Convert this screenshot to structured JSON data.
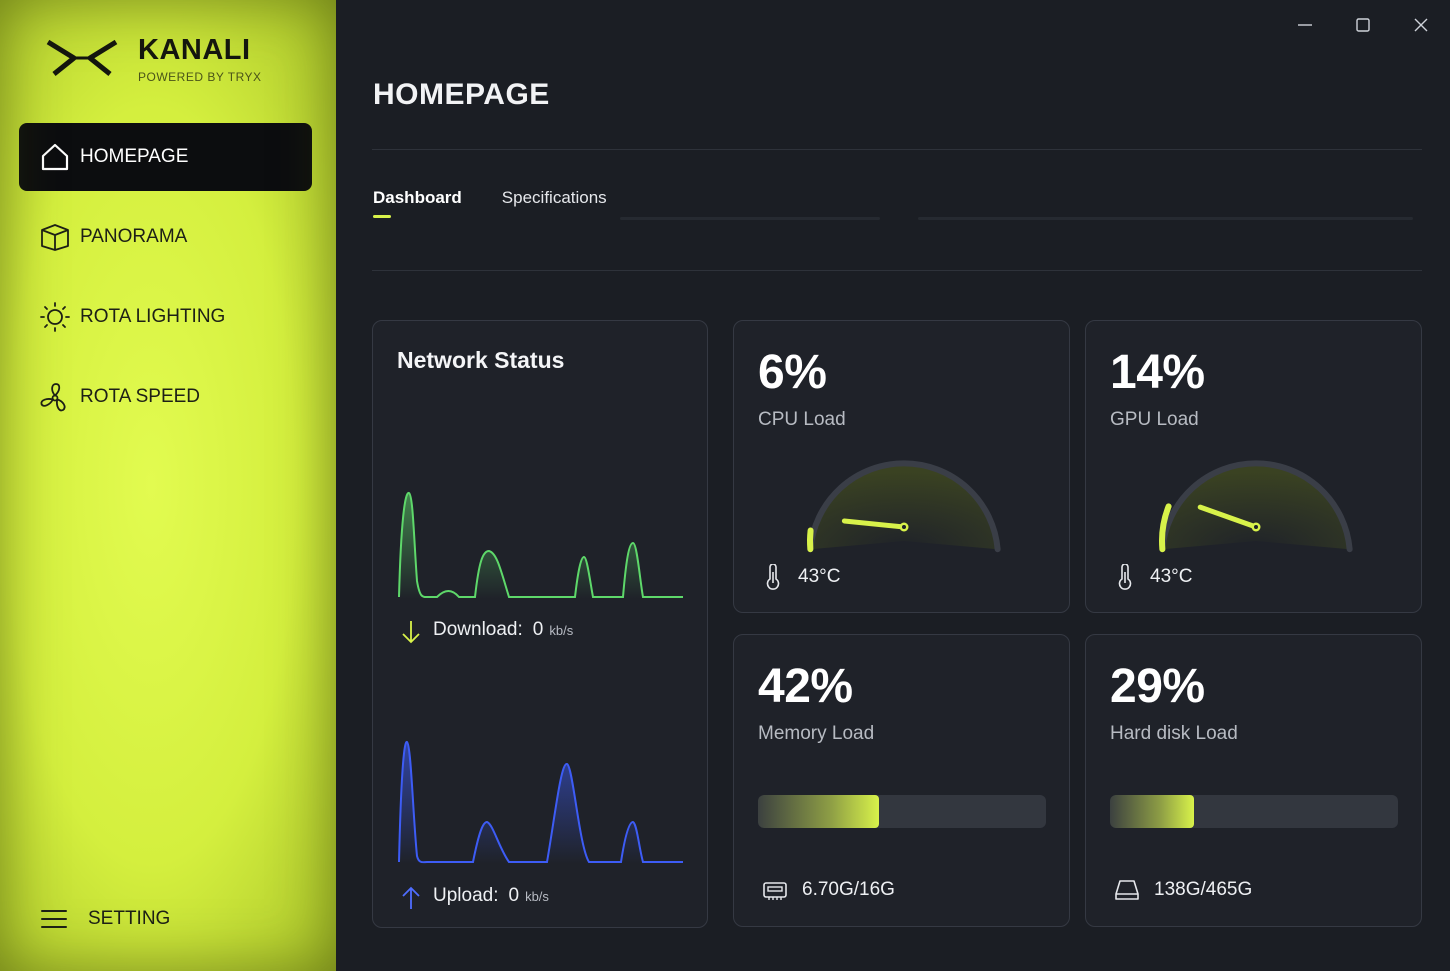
{
  "brand": {
    "name": "KANALI",
    "subtitle": "POWERED BY TRYX"
  },
  "nav": [
    {
      "label": "HOMEPAGE",
      "icon": "home-icon",
      "active": true
    },
    {
      "label": "PANORAMA",
      "icon": "box-icon",
      "active": false
    },
    {
      "label": "ROTA LIGHTING",
      "icon": "sun-icon",
      "active": false
    },
    {
      "label": "ROTA SPEED",
      "icon": "fan-icon",
      "active": false
    }
  ],
  "setting": {
    "label": "SETTING",
    "icon": "menu-icon"
  },
  "window": {
    "controls": [
      "minimize-icon",
      "maximize-icon",
      "close-icon"
    ]
  },
  "page": {
    "title": "HOMEPAGE"
  },
  "tabs": [
    {
      "label": "Dashboard",
      "active": true
    },
    {
      "label": "Specifications",
      "active": false
    }
  ],
  "network": {
    "title": "Network Status",
    "download": {
      "label": "Download:",
      "value": "0",
      "unit": "kb/s",
      "color": "#5ed86a"
    },
    "upload": {
      "label": "Upload:",
      "value": "0",
      "unit": "kb/s",
      "color": "#3d5cf5"
    }
  },
  "cpu": {
    "value": "6%",
    "label": "CPU Load",
    "temp": "43°C",
    "load": 6
  },
  "gpu": {
    "value": "14%",
    "label": "GPU Load",
    "temp": "43°C",
    "load": 14
  },
  "memory": {
    "value": "42%",
    "label": "Memory Load",
    "usage": "6.70G/16G",
    "load": 42
  },
  "disk": {
    "value": "29%",
    "label": "Hard disk Load",
    "usage": "138G/465G",
    "load": 29
  },
  "colors": {
    "accent": "#d8f24a",
    "background": "#1b1e24",
    "card": "#1f2229"
  }
}
